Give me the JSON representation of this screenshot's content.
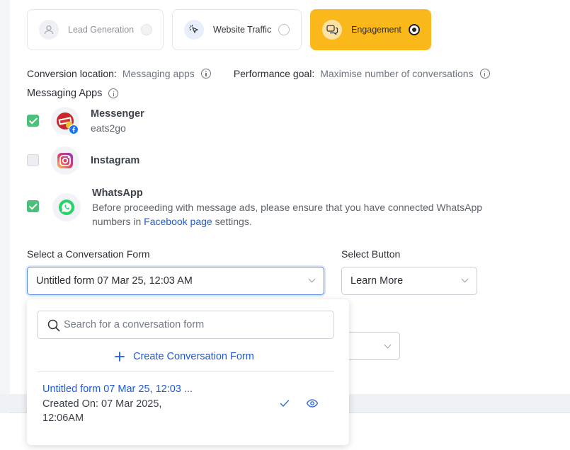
{
  "objectives": {
    "lead_generation": "Lead Generation",
    "website_traffic": "Website Traffic",
    "engagement": "Engagement",
    "selected": "Engagement"
  },
  "conversion_location": {
    "label": "Conversion location:",
    "value": "Messaging apps"
  },
  "performance_goal": {
    "label": "Performance goal:",
    "value": "Maximise number of conversations"
  },
  "messaging_apps": {
    "title": "Messaging Apps",
    "apps": [
      {
        "name": "Messenger",
        "sub": "eats2go",
        "checked": true,
        "icon": "messenger-page-logo"
      },
      {
        "name": "Instagram",
        "checked": false,
        "icon": "instagram-icon"
      },
      {
        "name": "WhatsApp",
        "checked": true,
        "icon": "whatsapp-icon",
        "note_before": "Before proceeding with message ads, please ensure that you have connected WhatsApp numbers in ",
        "note_link": "Facebook page",
        "note_after": " settings."
      }
    ]
  },
  "conversation_form": {
    "label": "Select a Conversation Form",
    "selected": "Untitled form 07 Mar 25, 12:03 AM"
  },
  "select_button": {
    "label": "Select Button",
    "selected": "Learn More"
  },
  "dropdown": {
    "search_placeholder": "Search for a conversation form",
    "create_label": "Create Conversation Form",
    "items": [
      {
        "title": "Untitled form 07 Mar 25, 12:03 ...",
        "meta": "Created On: 07 Mar 2025, 12:06AM"
      }
    ]
  },
  "colors": {
    "accent": "#fbb81b",
    "link": "#1e5bd8",
    "check": "#4cc07a"
  }
}
